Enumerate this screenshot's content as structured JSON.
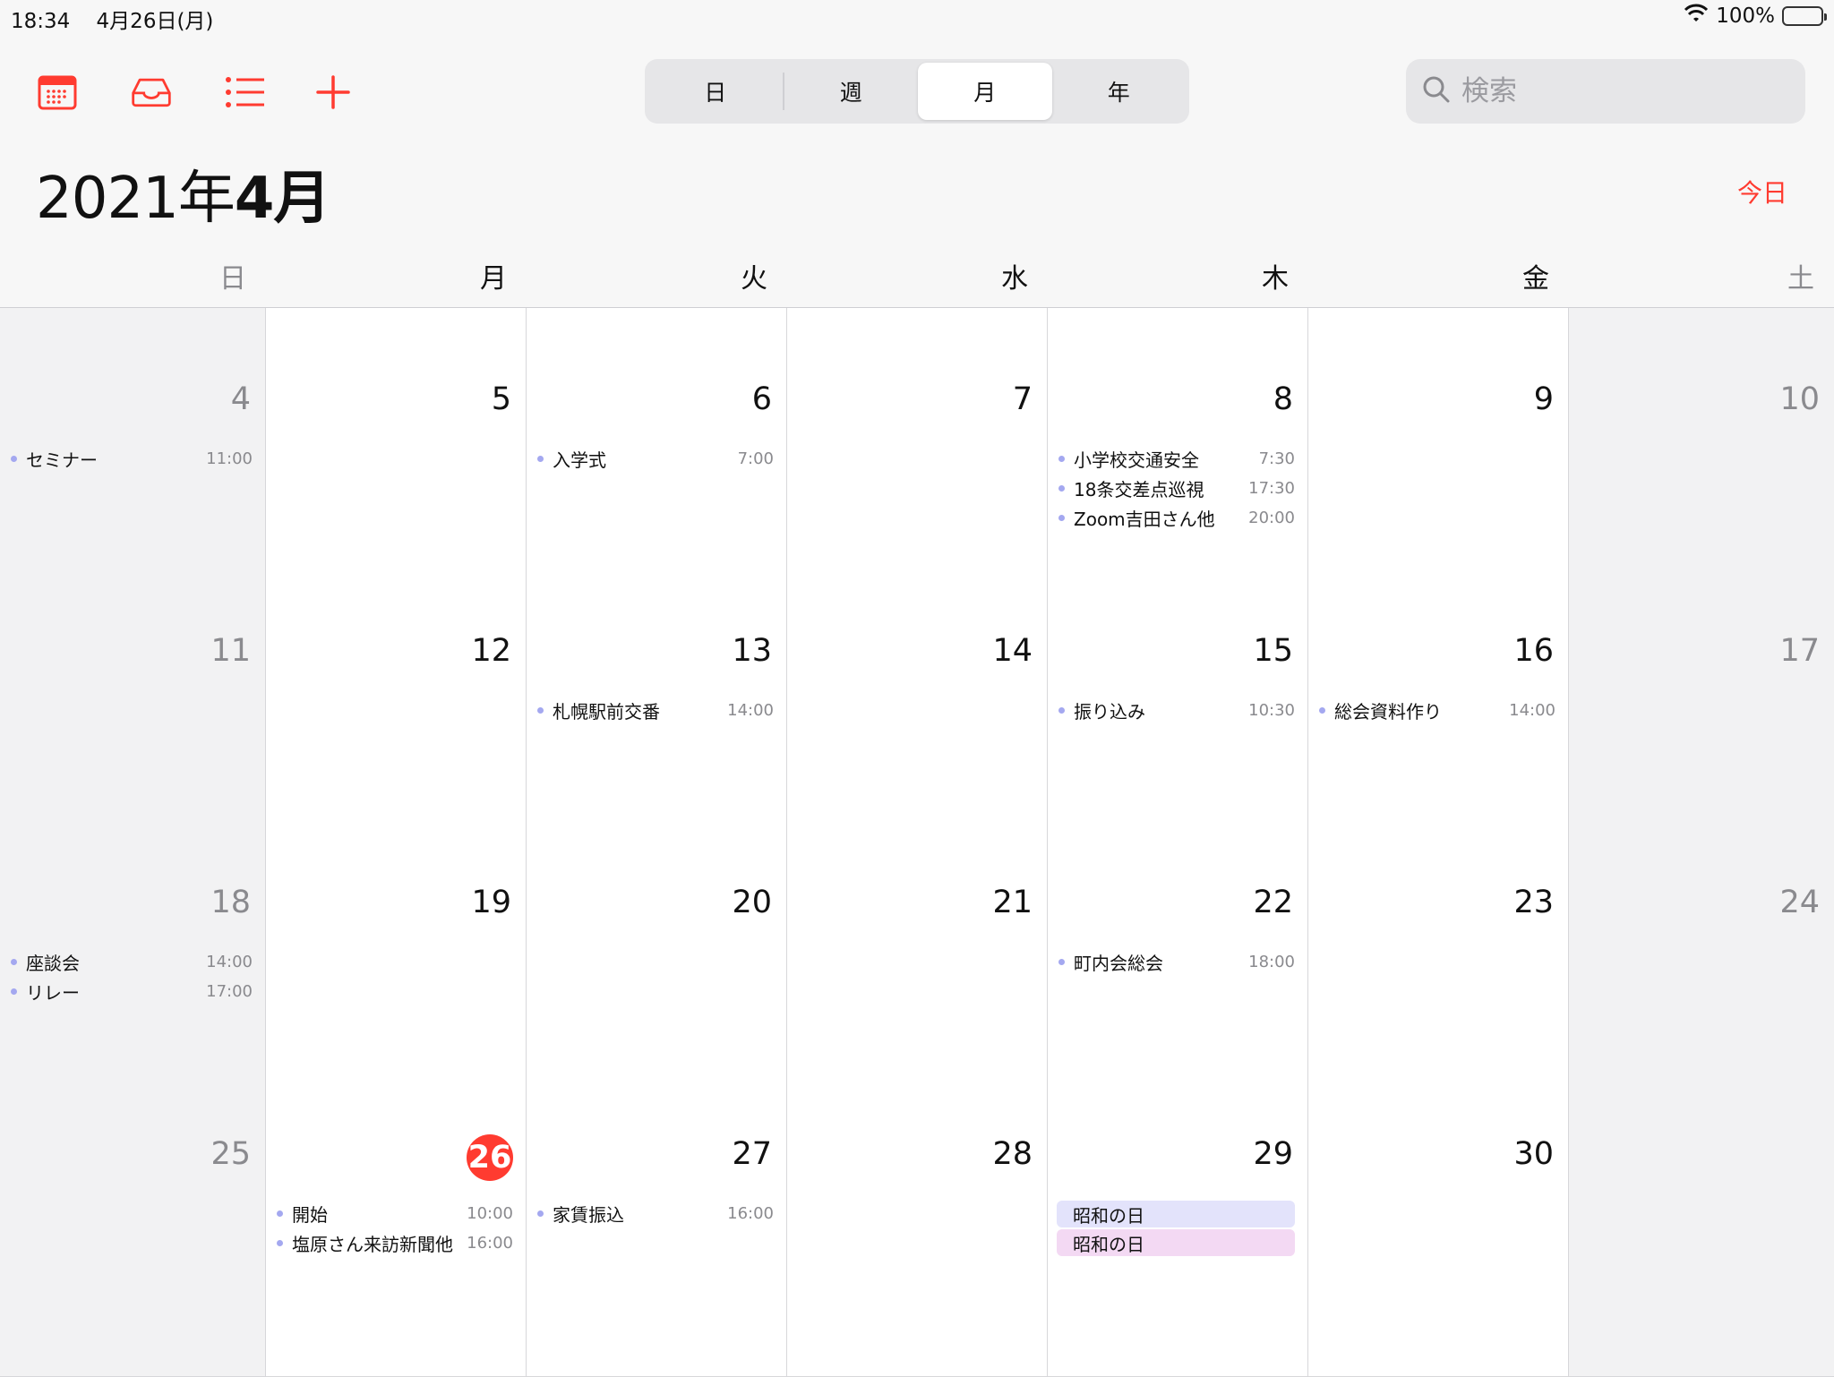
{
  "status_bar": {
    "time": "18:34",
    "date": "4月26日(月)",
    "battery": "100%"
  },
  "toolbar": {
    "segments": [
      "日",
      "週",
      "月",
      "年"
    ],
    "active_segment": "月",
    "search_placeholder": "検索"
  },
  "title": {
    "year": "2021年",
    "month": "4月"
  },
  "today_label": "今日",
  "weekdays": [
    "日",
    "月",
    "火",
    "水",
    "木",
    "金",
    "土"
  ],
  "colors": {
    "accent": "#ff3b30",
    "event_dot": "#a4a8f0",
    "allday1": "#e3e3fb",
    "allday2": "#f3d9f3"
  },
  "weeks": [
    {
      "days": [
        {
          "num": "",
          "events": []
        },
        {
          "num": "",
          "events": []
        },
        {
          "num": "",
          "events": []
        },
        {
          "num": "",
          "events": []
        },
        {
          "num": "",
          "events": []
        },
        {
          "num": "",
          "events": []
        },
        {
          "num": "",
          "events": []
        }
      ]
    },
    {
      "days": [
        {
          "num": "4",
          "events": [
            {
              "name": "セミナー",
              "time": "11:00"
            }
          ]
        },
        {
          "num": "5",
          "events": []
        },
        {
          "num": "6",
          "events": [
            {
              "name": "入学式",
              "time": "7:00"
            }
          ]
        },
        {
          "num": "7",
          "events": []
        },
        {
          "num": "8",
          "events": [
            {
              "name": "小学校交通安全",
              "time": "7:30"
            },
            {
              "name": "18条交差点巡視",
              "time": "17:30"
            },
            {
              "name": "Zoom吉田さん他",
              "time": "20:00"
            }
          ]
        },
        {
          "num": "9",
          "events": []
        },
        {
          "num": "10",
          "events": []
        }
      ]
    },
    {
      "days": [
        {
          "num": "11",
          "events": []
        },
        {
          "num": "12",
          "events": []
        },
        {
          "num": "13",
          "events": [
            {
              "name": "札幌駅前交番",
              "time": "14:00"
            }
          ]
        },
        {
          "num": "14",
          "events": []
        },
        {
          "num": "15",
          "events": [
            {
              "name": "振り込み",
              "time": "10:30"
            }
          ]
        },
        {
          "num": "16",
          "events": [
            {
              "name": "総会資料作り",
              "time": "14:00"
            }
          ]
        },
        {
          "num": "17",
          "events": []
        }
      ]
    },
    {
      "days": [
        {
          "num": "18",
          "events": [
            {
              "name": "座談会",
              "time": "14:00"
            },
            {
              "name": "リレー",
              "time": "17:00"
            }
          ]
        },
        {
          "num": "19",
          "events": []
        },
        {
          "num": "20",
          "events": []
        },
        {
          "num": "21",
          "events": []
        },
        {
          "num": "22",
          "events": [
            {
              "name": "町内会総会",
              "time": "18:00"
            }
          ]
        },
        {
          "num": "23",
          "events": []
        },
        {
          "num": "24",
          "events": []
        }
      ]
    },
    {
      "days": [
        {
          "num": "25",
          "events": []
        },
        {
          "num": "26",
          "today": true,
          "events": [
            {
              "name": "開始",
              "time": "10:00"
            },
            {
              "name": "塩原さん来訪新聞他",
              "time": "16:00"
            }
          ]
        },
        {
          "num": "27",
          "events": [
            {
              "name": "家賃振込",
              "time": "16:00"
            }
          ]
        },
        {
          "num": "28",
          "events": []
        },
        {
          "num": "29",
          "events": [
            {
              "name": "昭和の日",
              "allday": "c1"
            },
            {
              "name": "昭和の日",
              "allday": "c2"
            }
          ]
        },
        {
          "num": "30",
          "events": []
        },
        {
          "num": "",
          "events": []
        }
      ]
    }
  ]
}
